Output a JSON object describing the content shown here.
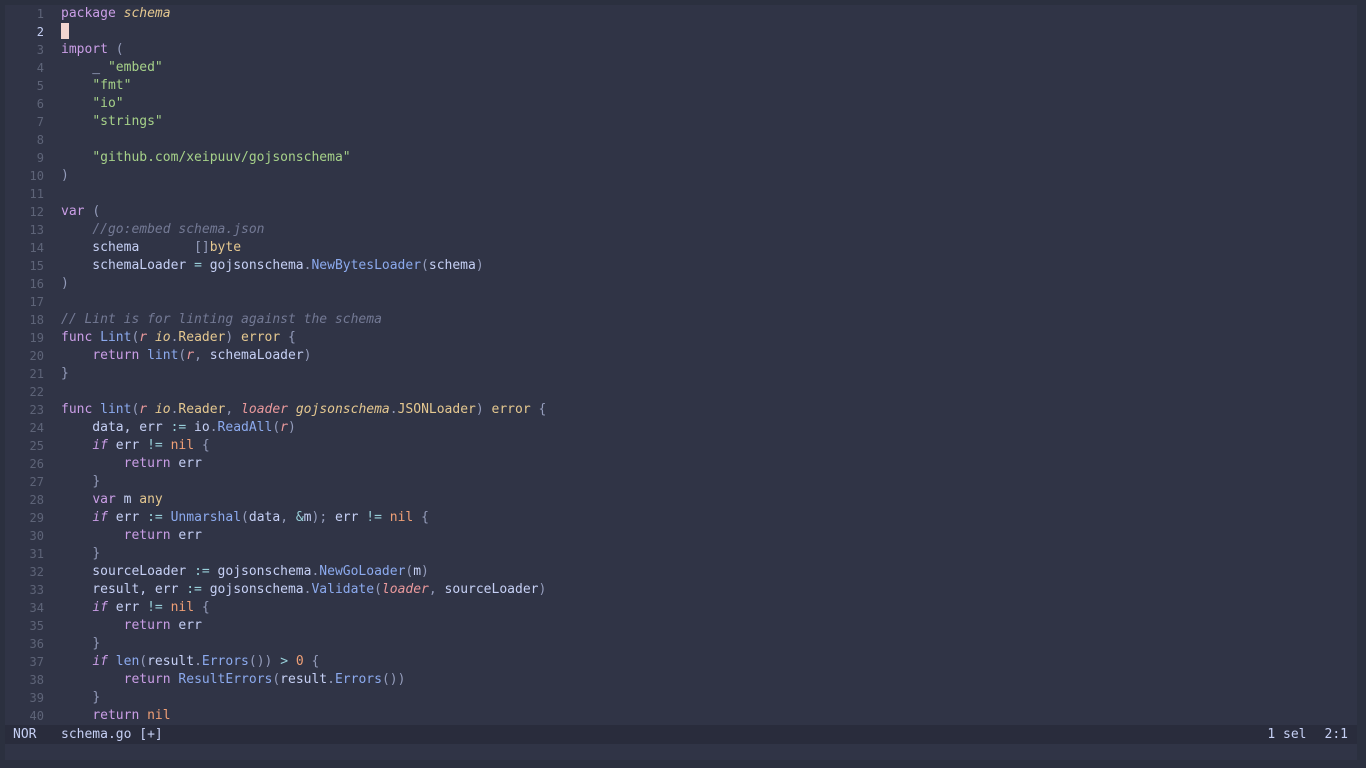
{
  "editor": {
    "cursor_line": 2,
    "lines": [
      {
        "n": "1",
        "t": [
          [
            "package",
            "k"
          ],
          [
            " "
          ],
          [
            "schema",
            "ti"
          ]
        ]
      },
      {
        "n": "2",
        "t": []
      },
      {
        "n": "3",
        "t": [
          [
            "import",
            "k"
          ],
          [
            " "
          ],
          [
            "(",
            "p"
          ]
        ]
      },
      {
        "n": "4",
        "t": [
          [
            "    _ "
          ],
          [
            "\"embed\"",
            "s"
          ]
        ]
      },
      {
        "n": "5",
        "t": [
          [
            "    "
          ],
          [
            "\"fmt\"",
            "s"
          ]
        ]
      },
      {
        "n": "6",
        "t": [
          [
            "    "
          ],
          [
            "\"io\"",
            "s"
          ]
        ]
      },
      {
        "n": "7",
        "t": [
          [
            "    "
          ],
          [
            "\"strings\"",
            "s"
          ]
        ]
      },
      {
        "n": "8",
        "t": []
      },
      {
        "n": "9",
        "t": [
          [
            "    "
          ],
          [
            "\"github.com/xeipuuv/gojsonschema\"",
            "s"
          ]
        ]
      },
      {
        "n": "10",
        "t": [
          [
            ")",
            "p"
          ]
        ]
      },
      {
        "n": "11",
        "t": []
      },
      {
        "n": "12",
        "t": [
          [
            "var",
            "k"
          ],
          [
            " "
          ],
          [
            "(",
            "p"
          ]
        ]
      },
      {
        "n": "13",
        "t": [
          [
            "    "
          ],
          [
            "//go:embed schema.json",
            "c"
          ]
        ]
      },
      {
        "n": "14",
        "t": [
          [
            "    schema       "
          ],
          [
            "[]",
            "p"
          ],
          [
            "byte",
            "ty"
          ]
        ]
      },
      {
        "n": "15",
        "t": [
          [
            "    schemaLoader "
          ],
          [
            "=",
            "o"
          ],
          [
            " gojsonschema"
          ],
          [
            ".",
            "p"
          ],
          [
            "NewBytesLoader",
            "f"
          ],
          [
            "(",
            "p"
          ],
          [
            "schema"
          ],
          [
            ")",
            "p"
          ]
        ]
      },
      {
        "n": "16",
        "t": [
          [
            ")",
            "p"
          ]
        ]
      },
      {
        "n": "17",
        "t": []
      },
      {
        "n": "18",
        "t": [
          [
            "// Lint is for linting against the schema",
            "c"
          ]
        ]
      },
      {
        "n": "19",
        "t": [
          [
            "func",
            "k"
          ],
          [
            " "
          ],
          [
            "Lint",
            "f"
          ],
          [
            "(",
            "p"
          ],
          [
            "r",
            "pa"
          ],
          [
            " "
          ],
          [
            "io",
            "ti"
          ],
          [
            ".",
            "p"
          ],
          [
            "Reader",
            "ty"
          ],
          [
            ")",
            "p"
          ],
          [
            " "
          ],
          [
            "error",
            "ty"
          ],
          [
            " {",
            "p"
          ]
        ]
      },
      {
        "n": "20",
        "t": [
          [
            "    "
          ],
          [
            "return",
            "k"
          ],
          [
            " "
          ],
          [
            "lint",
            "f"
          ],
          [
            "(",
            "p"
          ],
          [
            "r",
            "pa"
          ],
          [
            ", ",
            "p"
          ],
          [
            "schemaLoader"
          ],
          [
            ")",
            "p"
          ]
        ]
      },
      {
        "n": "21",
        "t": [
          [
            "}",
            "p"
          ]
        ]
      },
      {
        "n": "22",
        "t": []
      },
      {
        "n": "23",
        "t": [
          [
            "func",
            "k"
          ],
          [
            " "
          ],
          [
            "lint",
            "f"
          ],
          [
            "(",
            "p"
          ],
          [
            "r",
            "pa"
          ],
          [
            " "
          ],
          [
            "io",
            "ti"
          ],
          [
            ".",
            "p"
          ],
          [
            "Reader",
            "ty"
          ],
          [
            ", ",
            "p"
          ],
          [
            "loader",
            "pa"
          ],
          [
            " "
          ],
          [
            "gojsonschema",
            "ti"
          ],
          [
            ".",
            "p"
          ],
          [
            "JSONLoader",
            "ty"
          ],
          [
            ")",
            "p"
          ],
          [
            " "
          ],
          [
            "error",
            "ty"
          ],
          [
            " {",
            "p"
          ]
        ]
      },
      {
        "n": "24",
        "t": [
          [
            "    data, err "
          ],
          [
            ":=",
            "o"
          ],
          [
            " io"
          ],
          [
            ".",
            "p"
          ],
          [
            "ReadAll",
            "f"
          ],
          [
            "(",
            "p"
          ],
          [
            "r",
            "pa"
          ],
          [
            ")",
            "p"
          ]
        ]
      },
      {
        "n": "25",
        "t": [
          [
            "    "
          ],
          [
            "if",
            "ki"
          ],
          [
            " err "
          ],
          [
            "!=",
            "o"
          ],
          [
            " "
          ],
          [
            "nil",
            "n"
          ],
          [
            " {",
            "p"
          ]
        ]
      },
      {
        "n": "26",
        "t": [
          [
            "        "
          ],
          [
            "return",
            "k"
          ],
          [
            " err"
          ]
        ]
      },
      {
        "n": "27",
        "t": [
          [
            "    "
          ],
          [
            "}",
            "p"
          ]
        ]
      },
      {
        "n": "28",
        "t": [
          [
            "    "
          ],
          [
            "var",
            "k"
          ],
          [
            " m "
          ],
          [
            "any",
            "ty"
          ]
        ]
      },
      {
        "n": "29",
        "t": [
          [
            "    "
          ],
          [
            "if",
            "ki"
          ],
          [
            " err "
          ],
          [
            ":=",
            "o"
          ],
          [
            " "
          ],
          [
            "Unmarshal",
            "f"
          ],
          [
            "(",
            "p"
          ],
          [
            "data"
          ],
          [
            ", ",
            "p"
          ],
          [
            "&",
            "o"
          ],
          [
            "m"
          ],
          [
            ")",
            "p"
          ],
          [
            ";",
            "p"
          ],
          [
            " err "
          ],
          [
            "!=",
            "o"
          ],
          [
            " "
          ],
          [
            "nil",
            "n"
          ],
          [
            " {",
            "p"
          ]
        ]
      },
      {
        "n": "30",
        "t": [
          [
            "        "
          ],
          [
            "return",
            "k"
          ],
          [
            " err"
          ]
        ]
      },
      {
        "n": "31",
        "t": [
          [
            "    "
          ],
          [
            "}",
            "p"
          ]
        ]
      },
      {
        "n": "32",
        "t": [
          [
            "    sourceLoader "
          ],
          [
            ":=",
            "o"
          ],
          [
            " gojsonschema"
          ],
          [
            ".",
            "p"
          ],
          [
            "NewGoLoader",
            "f"
          ],
          [
            "(",
            "p"
          ],
          [
            "m"
          ],
          [
            ")",
            "p"
          ]
        ]
      },
      {
        "n": "33",
        "t": [
          [
            "    result, err "
          ],
          [
            ":=",
            "o"
          ],
          [
            " gojsonschema"
          ],
          [
            ".",
            "p"
          ],
          [
            "Validate",
            "f"
          ],
          [
            "(",
            "p"
          ],
          [
            "loader",
            "pa"
          ],
          [
            ", ",
            "p"
          ],
          [
            "sourceLoader"
          ],
          [
            ")",
            "p"
          ]
        ]
      },
      {
        "n": "34",
        "t": [
          [
            "    "
          ],
          [
            "if",
            "ki"
          ],
          [
            " err "
          ],
          [
            "!=",
            "o"
          ],
          [
            " "
          ],
          [
            "nil",
            "n"
          ],
          [
            " {",
            "p"
          ]
        ]
      },
      {
        "n": "35",
        "t": [
          [
            "        "
          ],
          [
            "return",
            "k"
          ],
          [
            " err"
          ]
        ]
      },
      {
        "n": "36",
        "t": [
          [
            "    "
          ],
          [
            "}",
            "p"
          ]
        ]
      },
      {
        "n": "37",
        "t": [
          [
            "    "
          ],
          [
            "if",
            "ki"
          ],
          [
            " "
          ],
          [
            "len",
            "f"
          ],
          [
            "(",
            "p"
          ],
          [
            "result"
          ],
          [
            ".",
            "p"
          ],
          [
            "Errors",
            "f"
          ],
          [
            "())",
            "p"
          ],
          [
            " "
          ],
          [
            ">",
            "o"
          ],
          [
            " "
          ],
          [
            "0",
            "n"
          ],
          [
            " {",
            "p"
          ]
        ]
      },
      {
        "n": "38",
        "t": [
          [
            "        "
          ],
          [
            "return",
            "k"
          ],
          [
            " "
          ],
          [
            "ResultErrors",
            "f"
          ],
          [
            "(",
            "p"
          ],
          [
            "result"
          ],
          [
            ".",
            "p"
          ],
          [
            "Errors",
            "f"
          ],
          [
            "())",
            "p"
          ]
        ]
      },
      {
        "n": "39",
        "t": [
          [
            "    "
          ],
          [
            "}",
            "p"
          ]
        ]
      },
      {
        "n": "40",
        "t": [
          [
            "    "
          ],
          [
            "return",
            "k"
          ],
          [
            " "
          ],
          [
            "nil",
            "n"
          ]
        ]
      }
    ]
  },
  "statusline": {
    "mode": "NOR",
    "filename": "schema.go [+]",
    "selections": "1 sel",
    "position": "2:1"
  },
  "colors": {
    "background": "#303446",
    "statusline": "#292c3c",
    "keyword": "#ca9ee6",
    "string": "#a6d189",
    "function": "#8caaee",
    "type": "#e5c890",
    "comment": "#737994",
    "parameter": "#ea999c",
    "constant": "#ef9f76",
    "cursor": "#f2d5cf"
  }
}
